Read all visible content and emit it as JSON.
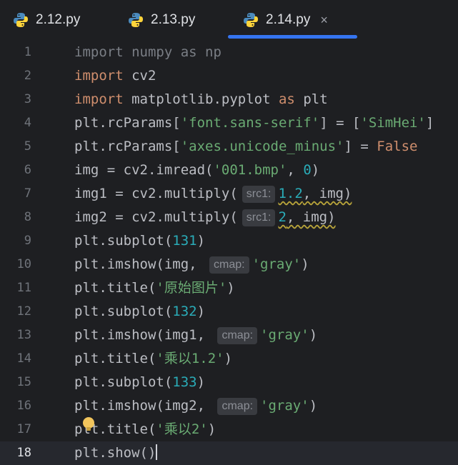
{
  "tabs": [
    {
      "label": "2.12.py",
      "icon": "python-icon",
      "active": false
    },
    {
      "label": "2.13.py",
      "icon": "python-icon",
      "active": false
    },
    {
      "label": "2.14.py",
      "icon": "python-icon",
      "active": true,
      "close": "×"
    }
  ],
  "colors": {
    "accent": "#3574f0",
    "keyword": "#cf8e6d",
    "string": "#6aab73",
    "number": "#2aacb8",
    "hint_bg": "#393b40"
  },
  "editor": {
    "current_line": 18,
    "lines": [
      {
        "n": "1",
        "t1": "import numpy as np"
      },
      {
        "n": "2",
        "kw": "import",
        "t1": " cv2"
      },
      {
        "n": "3",
        "kw": "import",
        "t1": " matplotlib.pyplot ",
        "kw2": "as",
        "t2": " plt"
      },
      {
        "n": "4",
        "t1": "plt.rcParams[",
        "s1": "'font.sans-serif'",
        "t2": "] = [",
        "s2": "'SimHei'",
        "t3": "]"
      },
      {
        "n": "5",
        "t1": "plt.rcParams[",
        "s1": "'axes.unicode_minus'",
        "t2": "] = ",
        "kw": "False"
      },
      {
        "n": "6",
        "t1": "img = cv2.imread(",
        "s1": "'001.bmp'",
        "t2": ", ",
        "num": "0",
        "t3": ")"
      },
      {
        "n": "7",
        "t1": "img1 = cv2.multiply(",
        "hint": "src1:",
        "num": "1.2",
        "t2": ", img)"
      },
      {
        "n": "8",
        "t1": "img2 = cv2.multiply(",
        "hint": "src1:",
        "num": "2",
        "t2": ", img)"
      },
      {
        "n": "9",
        "t1": "plt.subplot(",
        "num": "131",
        "t2": ")"
      },
      {
        "n": "10",
        "t1": "plt.imshow(img, ",
        "hint": "cmap:",
        "s1": "'gray'",
        "t2": ")"
      },
      {
        "n": "11",
        "t1": "plt.title(",
        "s1": "'原始图片'",
        "t2": ")"
      },
      {
        "n": "12",
        "t1": "plt.subplot(",
        "num": "132",
        "t2": ")"
      },
      {
        "n": "13",
        "t1": "plt.imshow(img1, ",
        "hint": "cmap:",
        "s1": "'gray'",
        "t2": ")"
      },
      {
        "n": "14",
        "t1": "plt.title(",
        "s1": "'乘以1.2'",
        "t2": ")"
      },
      {
        "n": "15",
        "t1": "plt.subplot(",
        "num": "133",
        "t2": ")"
      },
      {
        "n": "16",
        "t1": "plt.imshow(img2, ",
        "hint": "cmap:",
        "s1": "'gray'",
        "t2": ")"
      },
      {
        "n": "17",
        "t1": "plt.title(",
        "s1": "'乘以2'",
        "t2": ")"
      },
      {
        "n": "18",
        "t1": "plt.show()"
      }
    ]
  },
  "intention_icon": "lightbulb-icon"
}
